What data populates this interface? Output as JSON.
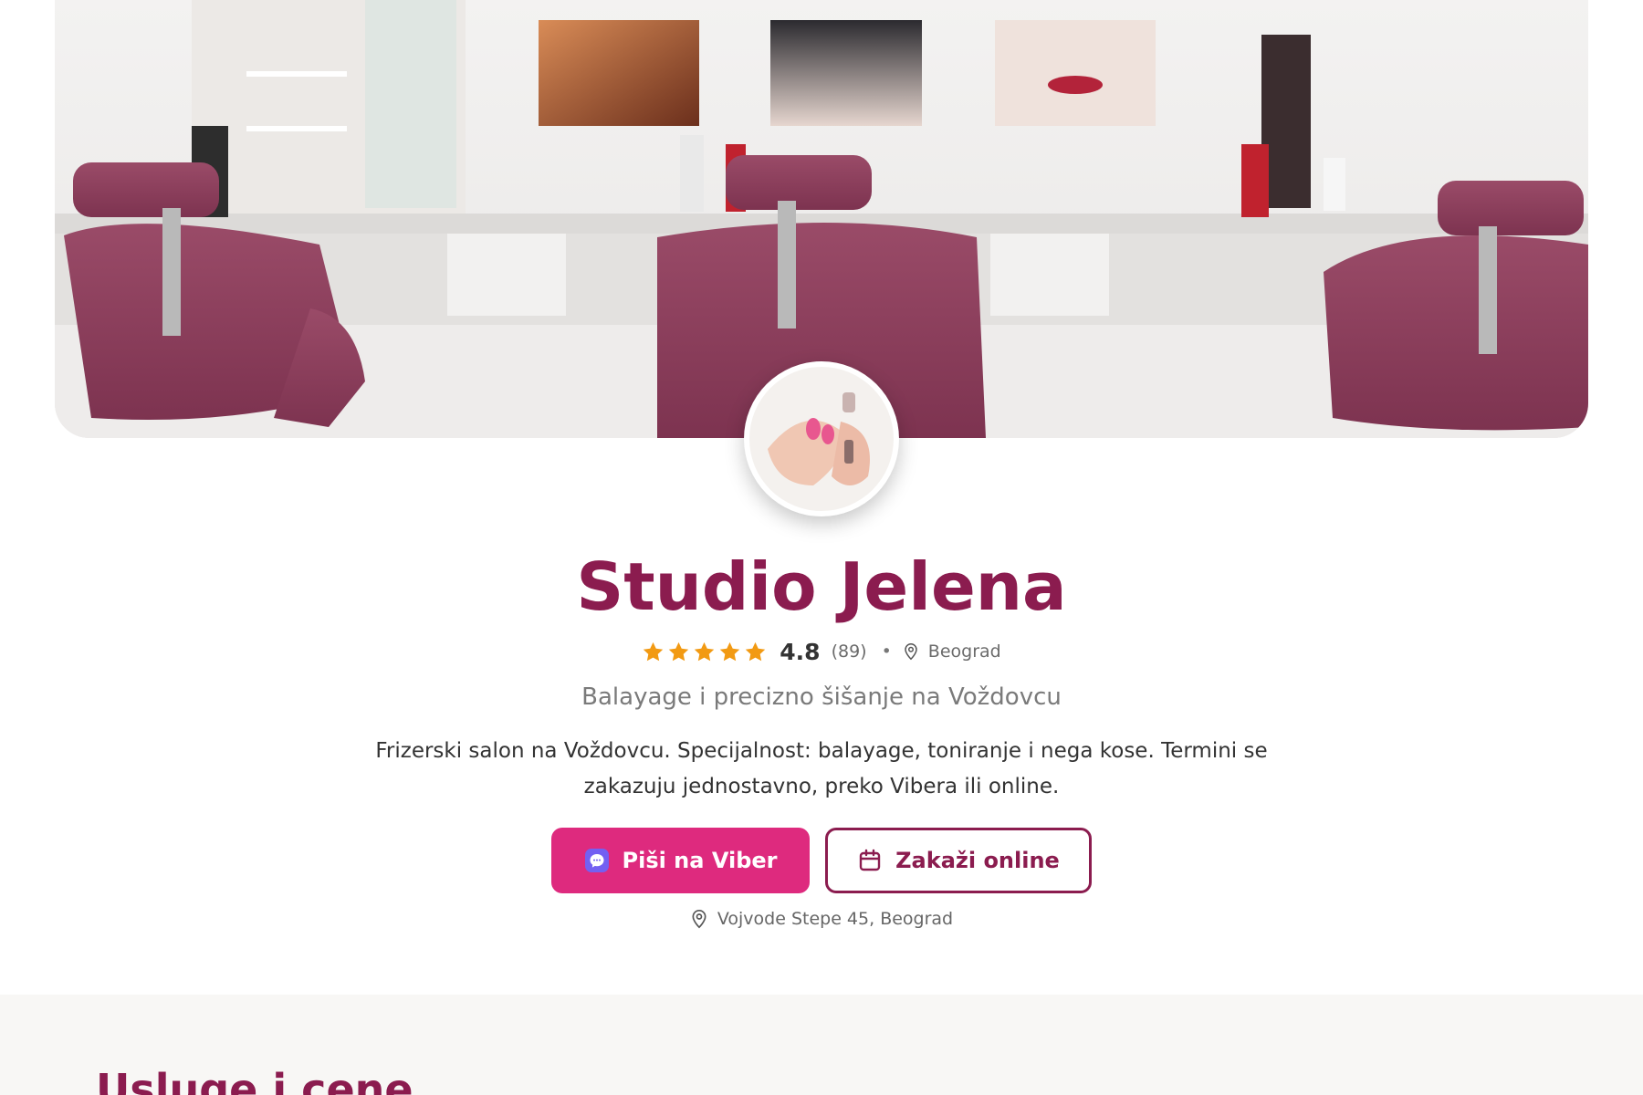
{
  "hero": {
    "image": "salon-interior-photo"
  },
  "avatar": {
    "image": "nail-polish-photo"
  },
  "profile": {
    "name": "Studio Jelena",
    "stars": 5,
    "rating": "4.8",
    "review_count": "(89)",
    "separator": "•",
    "city": "Beograd",
    "tagline": "Balayage i precizno šišanje na Voždovcu",
    "description": "Frizerski salon na Voždovcu. Specijalnost: balayage, toniranje i nega kose. Termini se zakazuju jednostavno, preko Vibera ili online."
  },
  "actions": {
    "viber_label": "Piši na Viber",
    "book_label": "Zakaži online"
  },
  "address": "Vojvode Stepe 45, Beograd",
  "services": {
    "heading": "Usluge i cene"
  },
  "colors": {
    "brand": "#8b1c4f",
    "accent": "#de2a7e",
    "star": "#f29a13",
    "viber": "#7360f2"
  },
  "icons": [
    "star-icon",
    "location-pin-icon",
    "viber-icon",
    "calendar-icon"
  ]
}
